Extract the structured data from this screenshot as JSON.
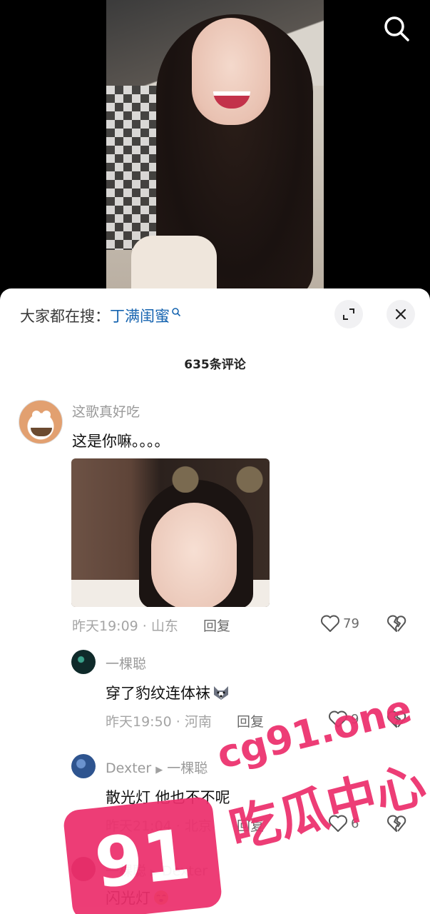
{
  "header": {
    "search_icon": "search-icon"
  },
  "sheet": {
    "search_prefix": "大家都在搜：",
    "search_keyword": "丁满闺蜜",
    "expand_icon": "expand-icon",
    "close_icon": "close-icon",
    "comment_count": "635条评论"
  },
  "comments": [
    {
      "user": "这歌真好吃",
      "text": "这是你嘛。。。。",
      "has_image": true,
      "time_location": "昨天19:09 · 山东",
      "reply_label": "回复",
      "likes": "79"
    },
    {
      "user": "一棵聪",
      "text": "穿了豹纹连体袜",
      "emoji": "husky-emoji",
      "time_location": "昨天19:50 · 河南",
      "reply_label": "回复",
      "likes": "9"
    },
    {
      "user": "Dexter",
      "reply_to": "一棵聪",
      "text": "散光灯 他也不不呢",
      "time_location": "昨天21:04 · 北京",
      "reply_label": "回复",
      "likes": "6"
    },
    {
      "user": "一棵聪",
      "reply_to": "Dexter",
      "text": "闪光灯",
      "emoji": "dizzy-emoji"
    }
  ],
  "watermark": {
    "number": "91",
    "domain": "cg91.one",
    "name": "吃瓜中心",
    "color": "#ec2f6c"
  }
}
